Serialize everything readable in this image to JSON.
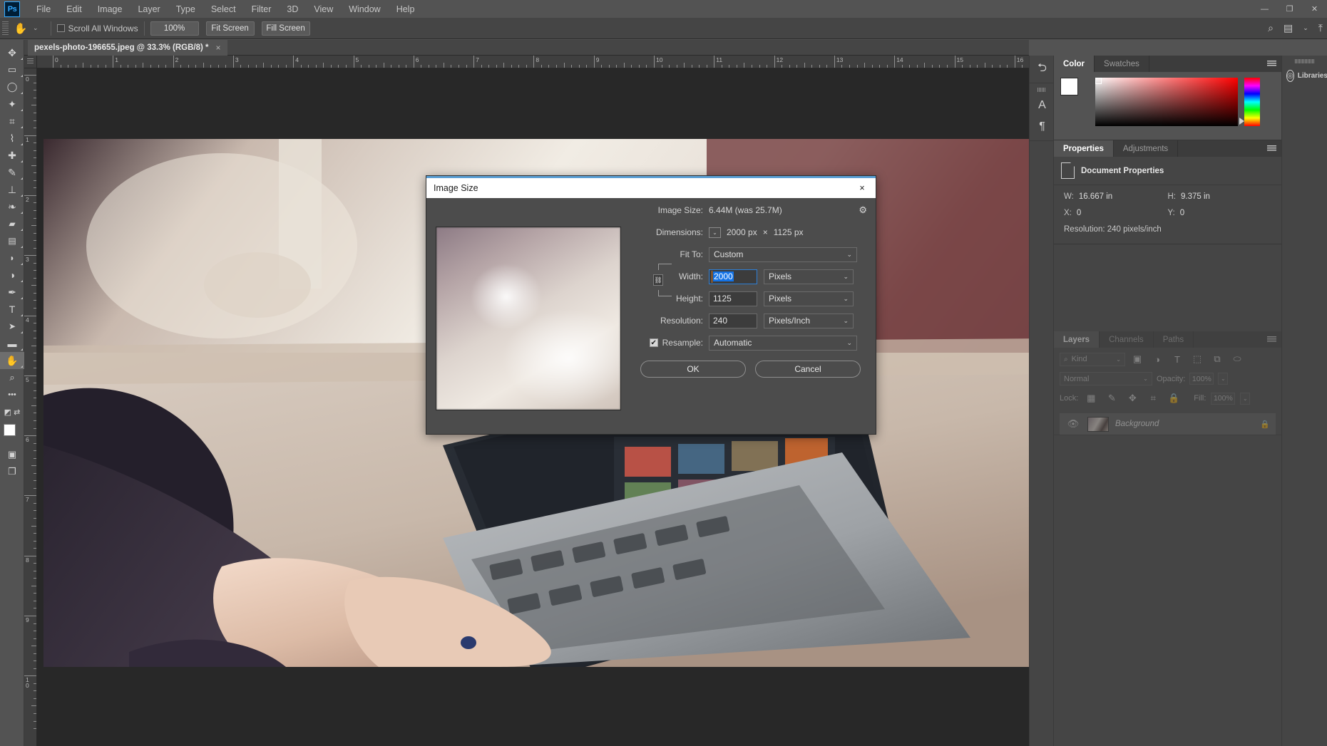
{
  "app": {
    "logo": "Ps",
    "title_bar_controls": [
      "minimize",
      "restore",
      "close"
    ]
  },
  "menubar": {
    "items": [
      "File",
      "Edit",
      "Image",
      "Layer",
      "Type",
      "Select",
      "Filter",
      "3D",
      "View",
      "Window",
      "Help"
    ]
  },
  "options_bar": {
    "tool_icon": "hand-icon",
    "scroll_all_windows": {
      "label": "Scroll All Windows",
      "checked": false
    },
    "buttons": [
      "100%",
      "Fit Screen",
      "Fill Screen"
    ],
    "right_icons": [
      "search-icon",
      "workspace-icon",
      "share-icon"
    ]
  },
  "toolbar": {
    "tools": [
      {
        "name": "move-tool",
        "glyph": "✥"
      },
      {
        "name": "marquee-tool",
        "glyph": "▭"
      },
      {
        "name": "lasso-tool",
        "glyph": "◯"
      },
      {
        "name": "quick-selection-tool",
        "glyph": "✦"
      },
      {
        "name": "crop-tool",
        "glyph": "⌗"
      },
      {
        "name": "eyedropper-tool",
        "glyph": "⌇"
      },
      {
        "name": "healing-brush-tool",
        "glyph": "✚"
      },
      {
        "name": "brush-tool",
        "glyph": "✎"
      },
      {
        "name": "clone-stamp-tool",
        "glyph": "⊥"
      },
      {
        "name": "history-brush-tool",
        "glyph": "❧"
      },
      {
        "name": "eraser-tool",
        "glyph": "▰"
      },
      {
        "name": "gradient-tool",
        "glyph": "▤"
      },
      {
        "name": "blur-tool",
        "glyph": "💧"
      },
      {
        "name": "dodge-tool",
        "glyph": "◑"
      },
      {
        "name": "pen-tool",
        "glyph": "✒"
      },
      {
        "name": "type-tool",
        "glyph": "T"
      },
      {
        "name": "path-selection-tool",
        "glyph": "➤"
      },
      {
        "name": "rectangle-tool",
        "glyph": "▬"
      },
      {
        "name": "hand-tool",
        "glyph": "✋",
        "active": true
      },
      {
        "name": "zoom-tool",
        "glyph": "🔍"
      },
      {
        "name": "more-tools",
        "glyph": "•••"
      }
    ],
    "foreground_color": "#ffffff",
    "background_color": "#ffffff",
    "quick-mask": "quick-mask-icon",
    "screen-mode": "screen-mode-icon"
  },
  "document": {
    "tab_label": "pexels-photo-196655.jpeg @ 33.3% (RGB/8) *",
    "close": "×"
  },
  "rulers": {
    "unit": "inches",
    "horizontal_labels": [
      "0",
      "1",
      "2",
      "3",
      "4",
      "5",
      "6",
      "7",
      "8",
      "9",
      "10",
      "11",
      "12",
      "13",
      "14",
      "15",
      "16"
    ],
    "vertical_labels": [
      "1",
      "0",
      "1",
      "2",
      "3",
      "4",
      "5",
      "6",
      "7",
      "8",
      "9",
      "10"
    ]
  },
  "dock_rail": {
    "icons": [
      "history-icon",
      "character-icon",
      "paragraph-icon"
    ]
  },
  "color_panel": {
    "tabs": [
      {
        "label": "Color",
        "selected": true
      },
      {
        "label": "Swatches",
        "selected": false
      }
    ],
    "menu": "panel-menu-icon",
    "foreground": "#ffffff",
    "background": "#ffffff"
  },
  "properties_panel": {
    "tabs": [
      {
        "label": "Properties",
        "selected": true
      },
      {
        "label": "Adjustments",
        "selected": false
      }
    ],
    "menu": "panel-menu-icon",
    "header": "Document Properties",
    "fields": [
      {
        "label": "W:",
        "value": "16.667 in"
      },
      {
        "label": "H:",
        "value": "9.375 in"
      },
      {
        "label": "X:",
        "value": "0"
      },
      {
        "label": "Y:",
        "value": "0"
      }
    ],
    "resolution": "Resolution: 240 pixels/inch"
  },
  "layers_panel": {
    "tabs": [
      {
        "label": "Layers",
        "selected": true
      },
      {
        "label": "Channels",
        "selected": false
      },
      {
        "label": "Paths",
        "selected": false
      }
    ],
    "menu": "panel-menu-icon",
    "filter": {
      "label": "Kind",
      "icon": "search-icon"
    },
    "filter_icons": [
      "pixel-filter-icon",
      "adjustment-filter-icon",
      "type-filter-icon",
      "shape-filter-icon",
      "smart-object-filter-icon",
      "filter-toggle-icon"
    ],
    "blend_mode": "Normal",
    "opacity": {
      "label": "Opacity:",
      "value": "100%"
    },
    "lock": {
      "label": "Lock:",
      "icons": [
        "lock-transparency-icon",
        "lock-image-icon",
        "lock-position-icon",
        "lock-artboard-icon",
        "lock-all-icon"
      ]
    },
    "fill": {
      "label": "Fill:",
      "value": "100%"
    },
    "rows": [
      {
        "name": "Background",
        "visible": true,
        "locked": true,
        "eye": "eye-icon",
        "lock": "lock-icon"
      }
    ]
  },
  "libraries_panel": {
    "label": "Libraries",
    "icon": "creative-cloud-icon"
  },
  "dialog": {
    "title": "Image Size",
    "close": "×",
    "gear": "gear-icon",
    "image_size": {
      "label": "Image Size:",
      "value": "6.44M (was 25.7M)"
    },
    "dimensions": {
      "label": "Dimensions:",
      "toggle": "chevron-down-icon",
      "width": "2000 px",
      "separator": "×",
      "height": "1125 px"
    },
    "fit_to": {
      "label": "Fit To:",
      "value": "Custom"
    },
    "width": {
      "label": "Width:",
      "value": "2000",
      "unit": "Pixels",
      "focused": true
    },
    "height": {
      "label": "Height:",
      "value": "1125",
      "unit": "Pixels"
    },
    "resolution": {
      "label": "Resolution:",
      "value": "240",
      "unit": "Pixels/Inch"
    },
    "resample": {
      "label": "Resample:",
      "checked": true,
      "value": "Automatic"
    },
    "link": "constrain-aspect-ratio-icon",
    "buttons": {
      "ok": "OK",
      "cancel": "Cancel"
    }
  },
  "colors": {
    "accent": "#31a8ff",
    "selection": "#1473e6",
    "panel_bg": "#454545",
    "app_bg": "#535353",
    "canvas_bg": "#282828",
    "dialog_bg": "#4c4c4c"
  }
}
